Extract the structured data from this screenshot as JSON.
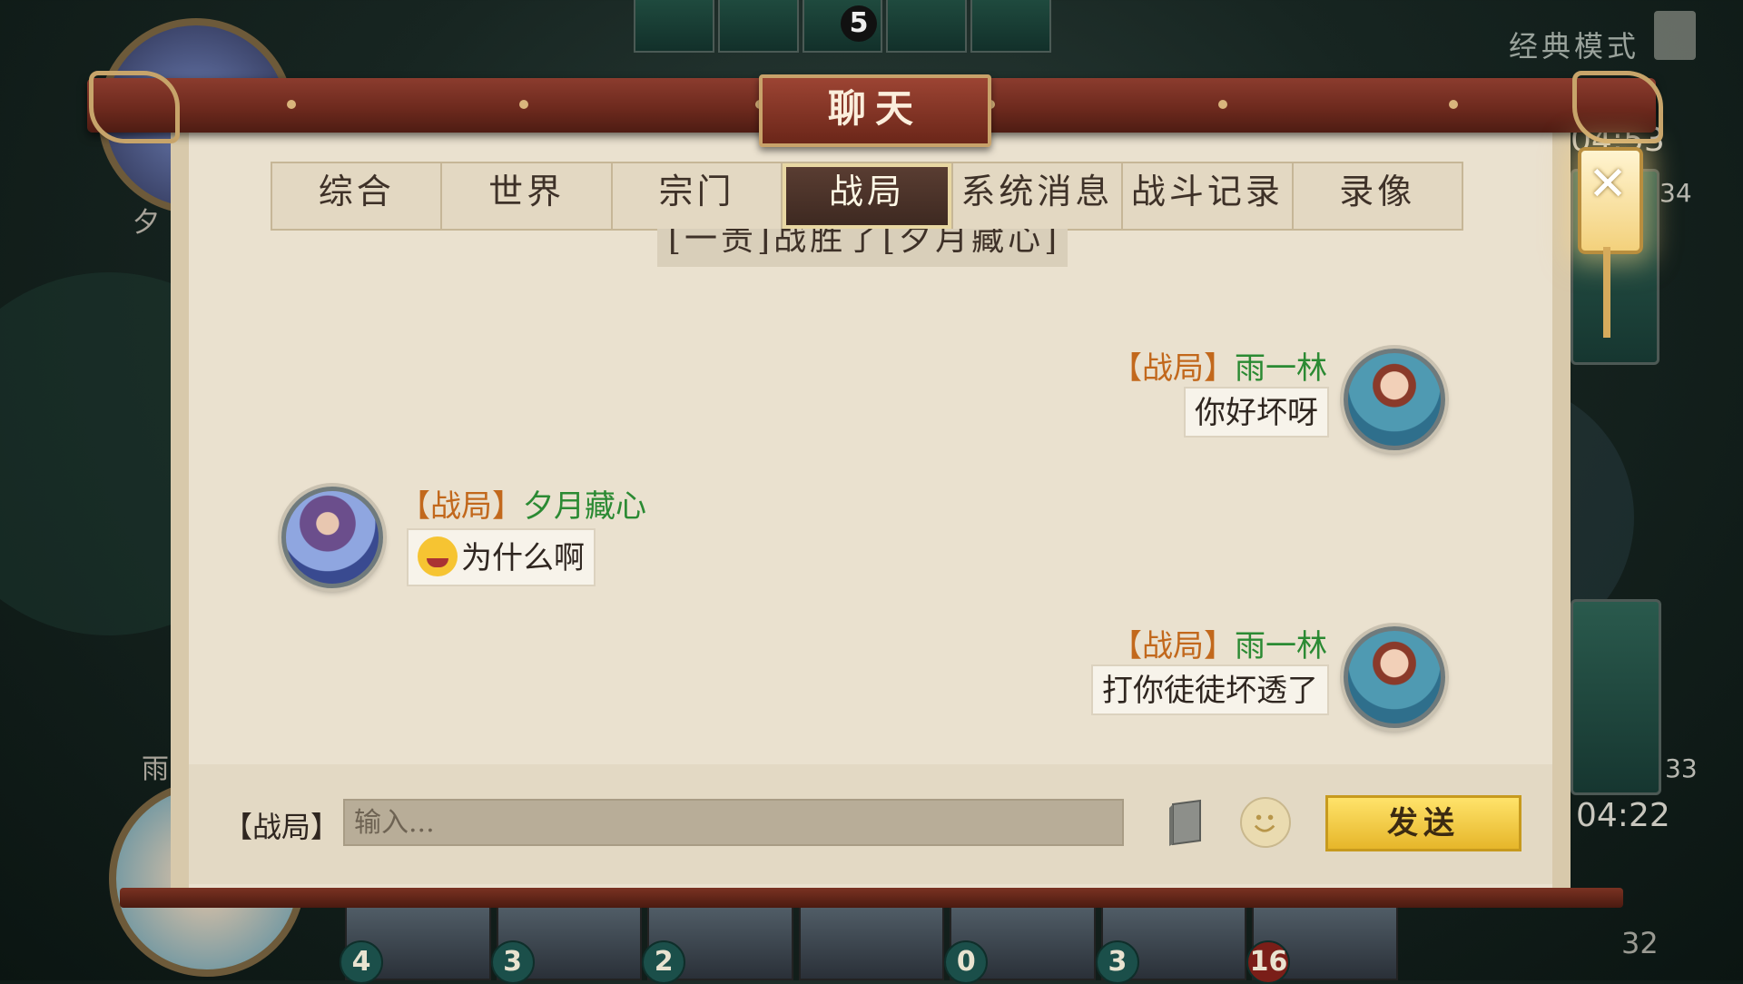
{
  "background": {
    "deck_count": "5",
    "mode_label": "经典模式",
    "opponent_name": "夕",
    "player_name": "雨",
    "count_top_right": "34",
    "count_bottom_right": "33",
    "timer_top": "04:53",
    "timer_bottom": "04:22",
    "pet_count": "32",
    "hand_costs": [
      "4",
      "3",
      "2",
      "",
      "0",
      "3",
      "16"
    ]
  },
  "panel": {
    "title": "聊天",
    "close_icon": "close-icon",
    "tabs": [
      {
        "label": "综合",
        "active": false
      },
      {
        "label": "世界",
        "active": false
      },
      {
        "label": "宗门",
        "active": false
      },
      {
        "label": "战局",
        "active": true
      },
      {
        "label": "系统消息",
        "active": false
      },
      {
        "label": "战斗记录",
        "active": false
      },
      {
        "label": "录像",
        "active": false
      }
    ]
  },
  "system_message": "[一责]战胜了[夕月藏心]",
  "messages": [
    {
      "channel": "【战局】",
      "sender": "雨一林",
      "text": "你好坏呀",
      "side": "right"
    },
    {
      "channel": "【战局】",
      "sender": "夕月藏心",
      "text": "为什么啊",
      "emoji": "crying-laughing-emoji",
      "side": "left"
    },
    {
      "channel": "【战局】",
      "sender": "雨一林",
      "text": "打你徒徒坏透了",
      "side": "right"
    }
  ],
  "input": {
    "channel_prefix": "【战局】",
    "placeholder": "输入...",
    "value": "",
    "send_label": "发送"
  },
  "colors": {
    "channel": "#c2681c",
    "sender": "#2b8a33",
    "title_bar": "#8b3c2e",
    "send_button": "#ffe36a"
  }
}
